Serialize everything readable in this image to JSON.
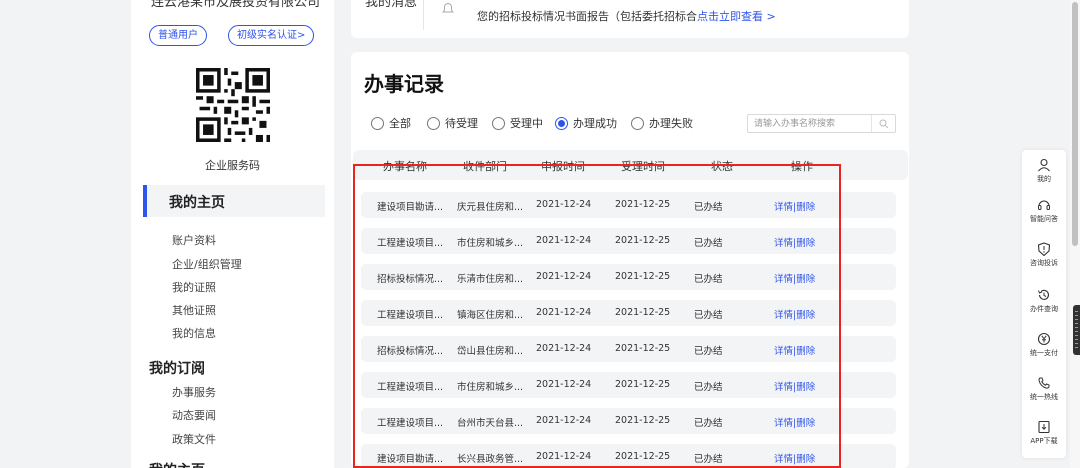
{
  "sidebar": {
    "company_name": "连云港某市及展投资有限公司",
    "tags": [
      "普通用户",
      "初级实名认证>"
    ],
    "qr_label": "企业服务码",
    "home": "我的主页",
    "home_items": [
      "账户资料",
      "企业/组织管理",
      "我的证照",
      "其他证照",
      "我的信息"
    ],
    "subscribe_title": "我的订阅",
    "subscribe_items": [
      "办事服务",
      "动态要闻",
      "政策文件"
    ],
    "next_section": "我的主页"
  },
  "notice": {
    "label": "我的消息",
    "text": "您的招标投标情况书面报告（包括委托招标合",
    "link": "点击立即查看 >"
  },
  "main": {
    "title": "办事记录",
    "filters": [
      {
        "label": "全部",
        "selected": false
      },
      {
        "label": "待受理",
        "selected": false
      },
      {
        "label": "受理中",
        "selected": false
      },
      {
        "label": "办理成功",
        "selected": true
      },
      {
        "label": "办理失败",
        "selected": false
      }
    ],
    "search_placeholder": "请输入办事名称搜索",
    "columns": [
      "办事名称",
      "收件部门",
      "申报时间",
      "受理时间",
      "状态",
      "操作"
    ],
    "rows": [
      [
        "建设项目勘请...",
        "庆元县住房和...",
        "2021-12-24",
        "2021-12-25",
        "已办结",
        "详情|删除"
      ],
      [
        "工程建设项目...",
        "市住房和城乡...",
        "2021-12-24",
        "2021-12-25",
        "已办结",
        "详情|删除"
      ],
      [
        "招标投标情况...",
        "乐清市住房和...",
        "2021-12-24",
        "2021-12-25",
        "已办结",
        "详情|删除"
      ],
      [
        "工程建设项目...",
        "镇海区住房和...",
        "2021-12-24",
        "2021-12-25",
        "已办结",
        "详情|删除"
      ],
      [
        "招标投标情况...",
        "岱山县住房和...",
        "2021-12-24",
        "2021-12-25",
        "已办结",
        "详情|删除"
      ],
      [
        "工程建设项目...",
        "市住房和城乡...",
        "2021-12-24",
        "2021-12-25",
        "已办结",
        "详情|删除"
      ],
      [
        "工程建设项目...",
        "台州市天台县...",
        "2021-12-24",
        "2021-12-25",
        "已办结",
        "详情|删除"
      ],
      [
        "建设项目勘请...",
        "长兴县政务管...",
        "2021-12-24",
        "2021-12-25",
        "已办结",
        "详情|删除"
      ]
    ]
  },
  "toolbar": [
    "我的",
    "智能问答",
    "咨询投诉",
    "办件查询",
    "统一支付",
    "统一热线",
    "APP下载"
  ],
  "colors": {
    "accent": "#2f54eb",
    "highlight": "#e8261f"
  }
}
